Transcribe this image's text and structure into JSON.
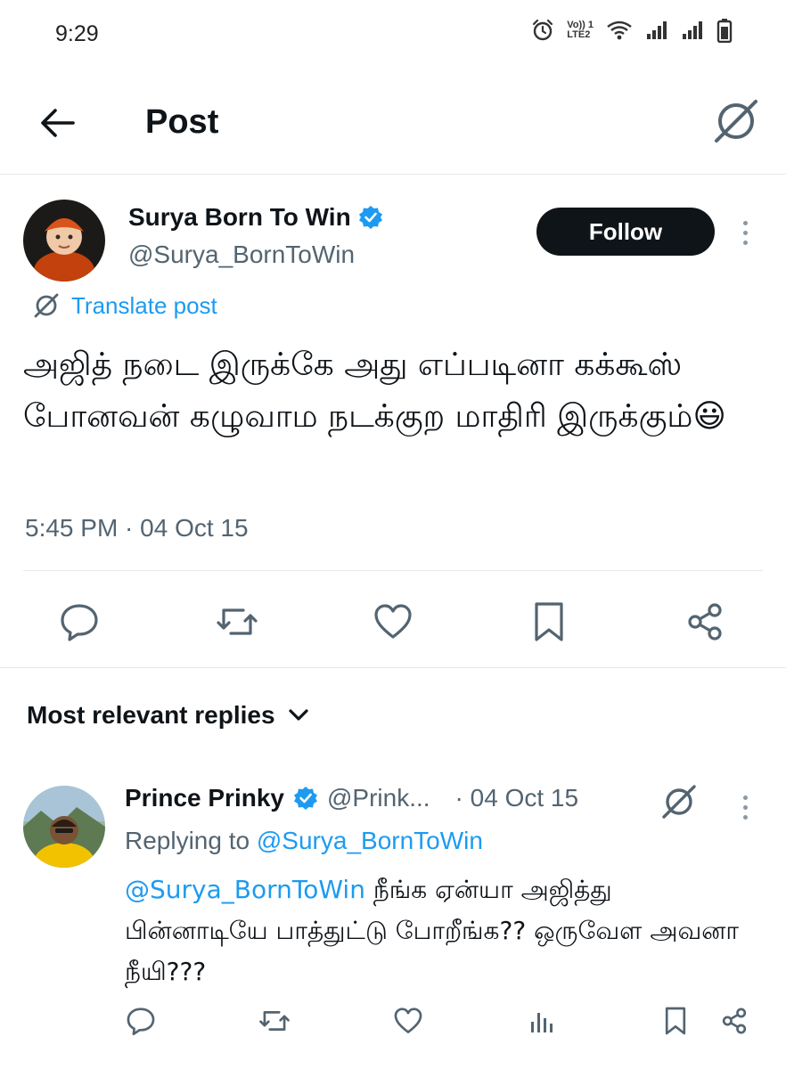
{
  "status_bar": {
    "time": "9:29",
    "icons": [
      "alarm-icon",
      "volte-icon",
      "wifi-icon",
      "signal-icon",
      "signal-icon",
      "battery-icon"
    ],
    "volte_line1": "Vo)) 1",
    "volte_line2": "LTE2"
  },
  "header": {
    "title": "Post",
    "back_icon": "back-arrow-icon",
    "translate_icon": "translate-icon"
  },
  "post": {
    "author_name": "Surya Born To Win",
    "verified": true,
    "author_handle": "@Surya_BornToWin",
    "follow_label": "Follow",
    "translate_label": "Translate post",
    "text": "அஜித்  நடை இருக்கே அது எப்படினா கக்கூஸ் போனவன் கழுவாம நடக்குற மாதிரி இருக்கும்😃",
    "timestamp": "5:45 PM · 04 Oct 15",
    "actions": [
      "reply-icon",
      "repost-icon",
      "like-icon",
      "bookmark-icon",
      "share-icon"
    ]
  },
  "replies": {
    "sort_label": "Most relevant replies",
    "items": [
      {
        "name": "Prince Prinky",
        "verified": true,
        "handle": "@Prink...",
        "date": "· 04 Oct 15",
        "replying_prefix": "Replying to ",
        "replying_to": "@Surya_BornToWin",
        "mention": "@Surya_BornToWin",
        "text": " நீங்க  ஏன்யா அஜித்து பின்னாடியே பாத்துட்டு போறீங்க?? ஒருவேள அவனா நீயி???",
        "actions": [
          "reply-icon",
          "repost-icon",
          "like-icon",
          "views-icon",
          "bookmark-icon",
          "share-icon"
        ]
      }
    ]
  },
  "colors": {
    "accent": "#1d9bf0",
    "text": "#0f1419",
    "secondary": "#536471",
    "divider": "#e6e9ec"
  }
}
